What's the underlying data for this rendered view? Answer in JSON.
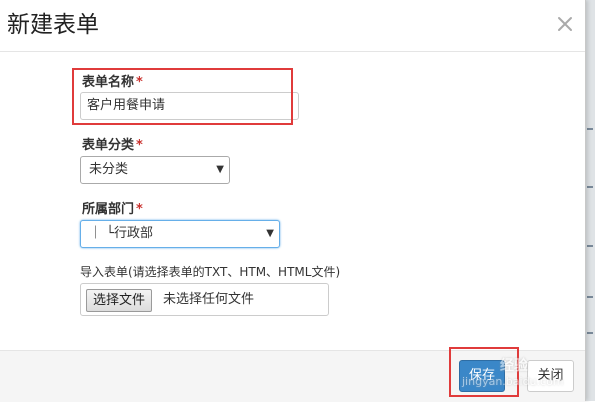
{
  "dialog": {
    "title": "新建表单",
    "close_icon": "close-icon"
  },
  "form": {
    "name": {
      "label": "表单名称",
      "required_mark": "*",
      "value": "客户用餐申请"
    },
    "category": {
      "label": "表单分类",
      "required_mark": "*",
      "selected": "未分类"
    },
    "department": {
      "label": "所属部门",
      "required_mark": "*",
      "selected": "｜ └行政部"
    },
    "import": {
      "label": "导入表单(请选择表单的TXT、HTM、HTML文件)",
      "button_label": "选择文件",
      "status": "未选择任何文件"
    }
  },
  "footer": {
    "save_label": "保存",
    "close_label": "关闭"
  },
  "watermark": {
    "brand": "经验",
    "url": "jingyan.baidu.com"
  },
  "colors": {
    "primary": "#3a87c8",
    "highlight": "#e03b3b",
    "required": "#c9302c"
  }
}
